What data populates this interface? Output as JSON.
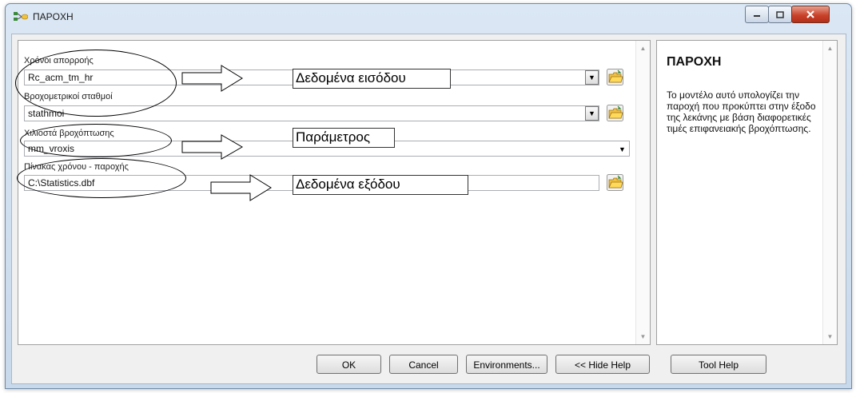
{
  "window": {
    "title": "ΠΑΡΟΧΗ",
    "controls": {
      "minimize": "minimize",
      "maximize": "maximize",
      "close": "close"
    }
  },
  "form": {
    "fields": [
      {
        "label": "Χρόνοι απορροής",
        "value": "Rc_acm_tm_hr",
        "has_browse": true,
        "has_dropdown": true
      },
      {
        "label": "Βροχομετρικοί σταθμοί",
        "value": "stathmoi",
        "has_browse": true,
        "has_dropdown": true
      },
      {
        "label": "Χιλιοστά βροχόπτωσης",
        "value": "mm_vroxis",
        "has_browse": false,
        "has_dropdown": true
      },
      {
        "label": "Πίνακας χρόνου - παροχής",
        "value": "C:\\Statistics.dbf",
        "has_browse": true,
        "has_dropdown": false
      }
    ],
    "annotations": {
      "input": "Δεδομένα εισόδου",
      "parameter": "Παράμετρος",
      "output": "Δεδομένα εξόδου"
    }
  },
  "help": {
    "title": "ΠΑΡΟΧΗ",
    "body": "Το μοντέλο αυτό υπολογίζει την παροχή που προκύπτει στην έξοδο της λεκάνης με βάση διαφορετικές τιμές επιφανειακής βροχόπτωσης."
  },
  "buttons": {
    "ok": "OK",
    "cancel": "Cancel",
    "environments": "Environments...",
    "hide_help": "<< Hide Help",
    "tool_help": "Tool Help"
  },
  "icons": {
    "title": "model-tool-icon",
    "browse": "open-folder-icon"
  }
}
